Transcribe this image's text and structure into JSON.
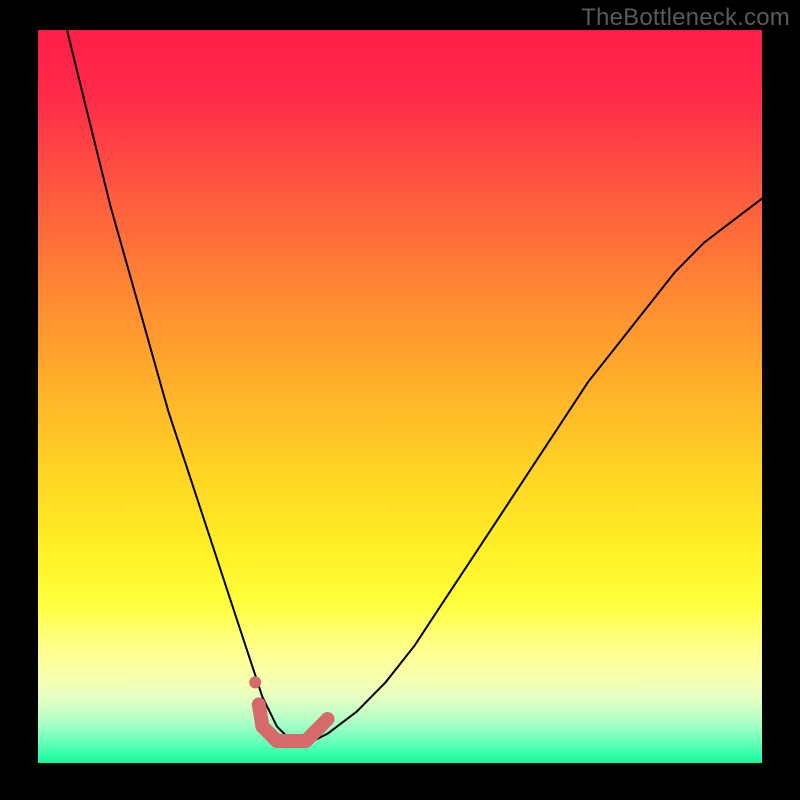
{
  "watermark": "TheBottleneck.com",
  "chart_data": {
    "type": "line",
    "title": "",
    "xlabel": "",
    "ylabel": "",
    "xlim": [
      0,
      100
    ],
    "ylim": [
      0,
      100
    ],
    "grid": false,
    "series": [
      {
        "name": "curve",
        "x": [
          4,
          6,
          8,
          10,
          12,
          14,
          16,
          18,
          20,
          22,
          24,
          26,
          28,
          30,
          31,
          32,
          33,
          34,
          35,
          36,
          38,
          40,
          44,
          48,
          52,
          56,
          60,
          64,
          68,
          72,
          76,
          80,
          84,
          88,
          92,
          96,
          100
        ],
        "y": [
          100,
          92,
          84,
          76,
          69,
          62,
          55,
          48,
          42,
          36,
          30,
          24,
          18,
          12,
          9,
          7,
          5,
          4,
          3,
          3,
          3,
          4,
          7,
          11,
          16,
          22,
          28,
          34,
          40,
          46,
          52,
          57,
          62,
          67,
          71,
          74,
          77
        ]
      }
    ],
    "markers": {
      "name": "highlight",
      "x": [
        30.5,
        31,
        32,
        33,
        34,
        35,
        36,
        37,
        38,
        39,
        40
      ],
      "y": [
        8,
        5,
        4,
        3,
        3,
        3,
        3,
        3,
        4,
        5,
        6
      ]
    },
    "marker_dot": {
      "x": 30,
      "y": 11
    },
    "background_gradient": {
      "top": "#ff1e49",
      "middle": "#ffff3b",
      "bottom": "#15f79a"
    }
  }
}
